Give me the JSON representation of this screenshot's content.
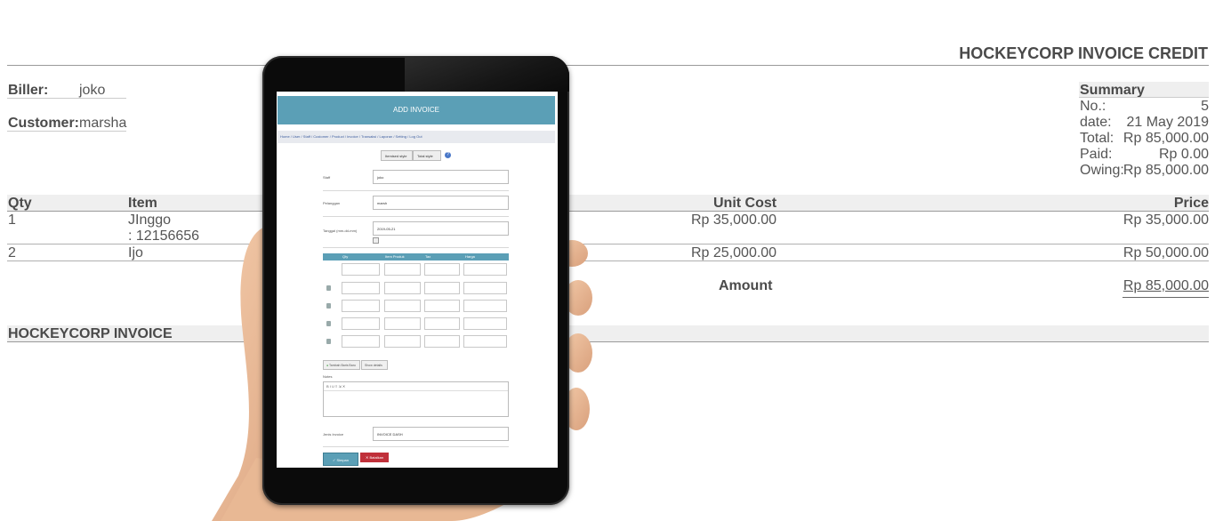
{
  "invoice": {
    "title": "HOCKEYCORP INVOICE CREDIT",
    "biller_label": "Biller:",
    "biller_value": "joko",
    "customer_label": "Customer:",
    "customer_value": "marsha",
    "summary": {
      "heading": "Summary",
      "rows": [
        {
          "label": "No.:",
          "value": "5"
        },
        {
          "label": "date:",
          "value": "21 May 2019"
        },
        {
          "label": "Total:",
          "value": "Rp 85,000.00"
        },
        {
          "label": "Paid:",
          "value": "Rp 0.00"
        },
        {
          "label": "Owing:",
          "value": "Rp 85,000.00"
        }
      ]
    },
    "table": {
      "headers": {
        "qty": "Qty",
        "item": "Item",
        "unit_cost": "Unit Cost",
        "price": "Price"
      },
      "rows": [
        {
          "qty": "1",
          "item": "JInggo",
          "item_code": ": 12156656",
          "unit_cost": "Rp 35,000.00",
          "price": "Rp 35,000.00"
        },
        {
          "qty": "2",
          "item": "Ijo",
          "unit_cost": "Rp 25,000.00",
          "price": "Rp 50,000.00"
        }
      ],
      "amount_label": "Amount",
      "amount_value": "Rp 85,000.00"
    },
    "footer_title": "HOCKEYCORP INVOICE"
  },
  "tablet": {
    "header_title": "ADD INVOICE",
    "nav": "Home / User / Staff / Customer / Product / Invoice / Transaksi / Laporan / Setting / Log Out",
    "style_buttons": [
      "Itemised style",
      "Total style"
    ],
    "fields": [
      {
        "label": "Staff",
        "value": "joko"
      },
      {
        "label": "Pelanggan",
        "value": "marsh"
      },
      {
        "label": "Tanggal (mm-dd-mm)",
        "value": "2019-05-21"
      }
    ],
    "table_headers": [
      "Qty",
      "Item Produk",
      "Tax",
      "Harga"
    ],
    "add_row_button": "Tambah Baris Baru",
    "details_button": "Show details",
    "notes_label": "Notes",
    "notes_toolbar": "B I U ≡ ⇲ ✕",
    "invoice_type_label": "Jenis Invoice",
    "invoice_type_value": "INVOICE DASH",
    "save_button": "✓ Simpan",
    "cancel_button": "✕ Batalkan"
  },
  "colors": {
    "accent": "#5b9fb6",
    "danger": "#c0303a",
    "band": "#efefef",
    "tablet_body": "#0b0b0b"
  },
  "icons": [
    "help-icon",
    "delete-row-icon",
    "add-icon",
    "calendar-icon"
  ]
}
